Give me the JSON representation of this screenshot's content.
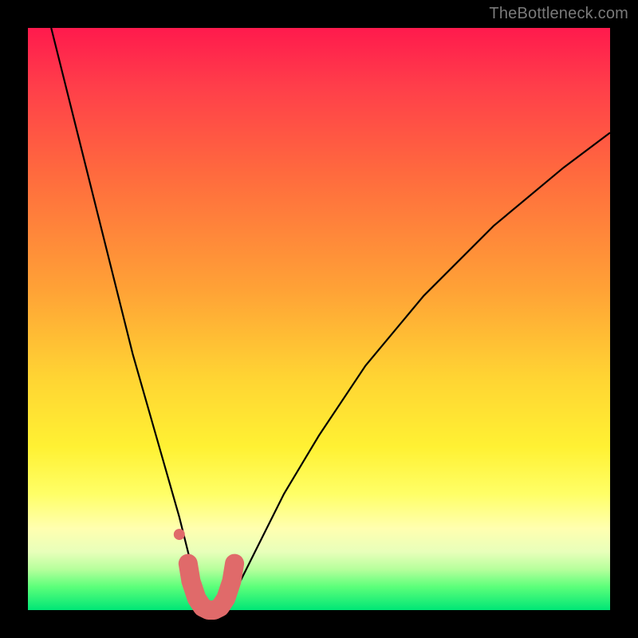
{
  "watermark": "TheBottleneck.com",
  "chart_data": {
    "type": "line",
    "title": "",
    "xlabel": "",
    "ylabel": "",
    "xlim": [
      0,
      100
    ],
    "ylim": [
      0,
      100
    ],
    "grid": false,
    "legend": false,
    "background_gradient": {
      "direction": "vertical",
      "stops": [
        {
          "pos": 0,
          "color": "#ff1a4d",
          "meaning": "worst"
        },
        {
          "pos": 50,
          "color": "#ffc933",
          "meaning": "mid"
        },
        {
          "pos": 85,
          "color": "#ffff80",
          "meaning": "near-optimal"
        },
        {
          "pos": 100,
          "color": "#00e676",
          "meaning": "optimal"
        }
      ]
    },
    "series": [
      {
        "name": "bottleneck-curve",
        "color": "#000000",
        "x": [
          4,
          6,
          8,
          10,
          12,
          14,
          16,
          18,
          20,
          22,
          24,
          26,
          27,
          28,
          29,
          30,
          31,
          32,
          33,
          34,
          36,
          38,
          40,
          44,
          50,
          58,
          68,
          80,
          92,
          100
        ],
        "y": [
          100,
          92,
          84,
          76,
          68,
          60,
          52,
          44,
          37,
          30,
          23,
          16,
          12,
          8,
          4,
          1,
          0,
          0,
          0,
          1,
          4,
          8,
          12,
          20,
          30,
          42,
          54,
          66,
          76,
          82
        ]
      },
      {
        "name": "highlight-floor",
        "color": "#e06a6a",
        "stroke_width": 14,
        "linecap": "round",
        "x": [
          27.5,
          28,
          29,
          30,
          31,
          32,
          33,
          34,
          35,
          35.5
        ],
        "y": [
          8,
          5,
          2,
          0.5,
          0,
          0,
          0.5,
          2,
          5,
          8
        ]
      }
    ],
    "markers": [
      {
        "name": "highlight-dot",
        "x": 26,
        "y": 13,
        "r": 6,
        "color": "#e06a6a"
      }
    ]
  }
}
